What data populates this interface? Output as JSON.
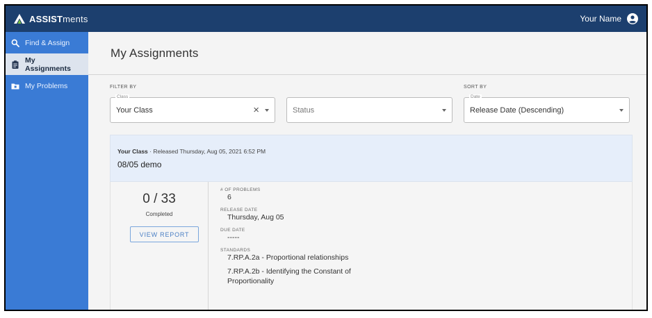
{
  "app": {
    "brand_strong": "ASSIST",
    "brand_light": "ments",
    "user_name": "Your Name"
  },
  "colors": {
    "topbar": "#1c3f6e",
    "sidebar": "#3a7bd5",
    "sidebar_active": "#dde4ee",
    "card_header": "#e6eefa",
    "accent": "#4a7fc4"
  },
  "sidebar": {
    "items": [
      {
        "label": "Find & Assign",
        "icon": "search-icon",
        "active": false
      },
      {
        "label": "My Assignments",
        "icon": "clipboard-icon",
        "active": true
      },
      {
        "label": "My Problems",
        "icon": "folder-icon",
        "active": false
      }
    ]
  },
  "page": {
    "title": "My Assignments"
  },
  "filters": {
    "filter_label": "FILTER BY",
    "sort_label": "SORT BY",
    "class_legend": "Class",
    "class_value": "Your Class",
    "status_placeholder": "Status",
    "date_legend": "Date",
    "date_value": "Release Date (Descending)"
  },
  "assignment": {
    "class_name": "Your Class",
    "released_text": " · Released Thursday, Aug 05, 2021 6:52 PM",
    "name": "08/05 demo",
    "progress": "0 / 33",
    "progress_label": "Completed",
    "report_button": "VIEW REPORT",
    "problems_label": "# OF PROBLEMS",
    "problems_value": "6",
    "release_label": "RELEASE DATE",
    "release_value": "Thursday, Aug 05",
    "due_label": "DUE DATE",
    "due_value": "-----",
    "standards_label": "STANDARDS",
    "standards": [
      "7.RP.A.2a - Proportional relationships",
      "7.RP.A.2b - Identifying the Constant of Proportionality"
    ]
  }
}
